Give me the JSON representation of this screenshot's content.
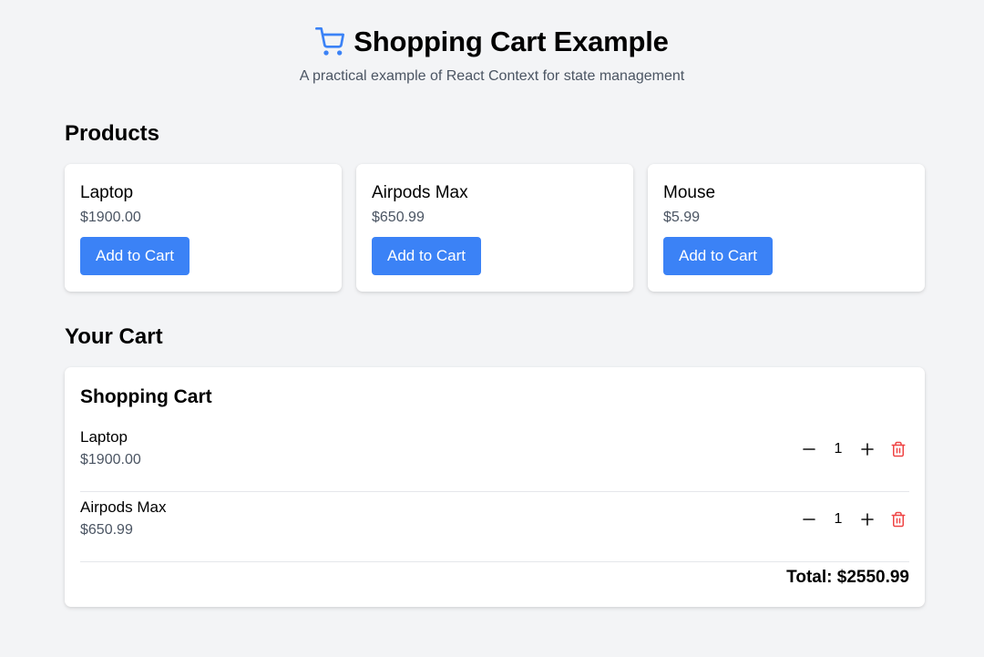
{
  "header": {
    "title": "Shopping Cart Example",
    "subtitle": "A practical example of React Context for state management",
    "icon": "shopping-cart-icon"
  },
  "products": {
    "heading": "Products",
    "items": [
      {
        "name": "Laptop",
        "price": "$1900.00",
        "button": "Add to Cart"
      },
      {
        "name": "Airpods Max",
        "price": "$650.99",
        "button": "Add to Cart"
      },
      {
        "name": "Mouse",
        "price": "$5.99",
        "button": "Add to Cart"
      }
    ]
  },
  "cart": {
    "heading": "Your Cart",
    "card_title": "Shopping Cart",
    "items": [
      {
        "name": "Laptop",
        "price": "$1900.00",
        "quantity": "1"
      },
      {
        "name": "Airpods Max",
        "price": "$650.99",
        "quantity": "1"
      }
    ],
    "total": "Total: $2550.99"
  },
  "colors": {
    "accent": "#3b82f6",
    "danger": "#ef4444",
    "background": "#f3f4f6",
    "muted_text": "#4b5563"
  }
}
